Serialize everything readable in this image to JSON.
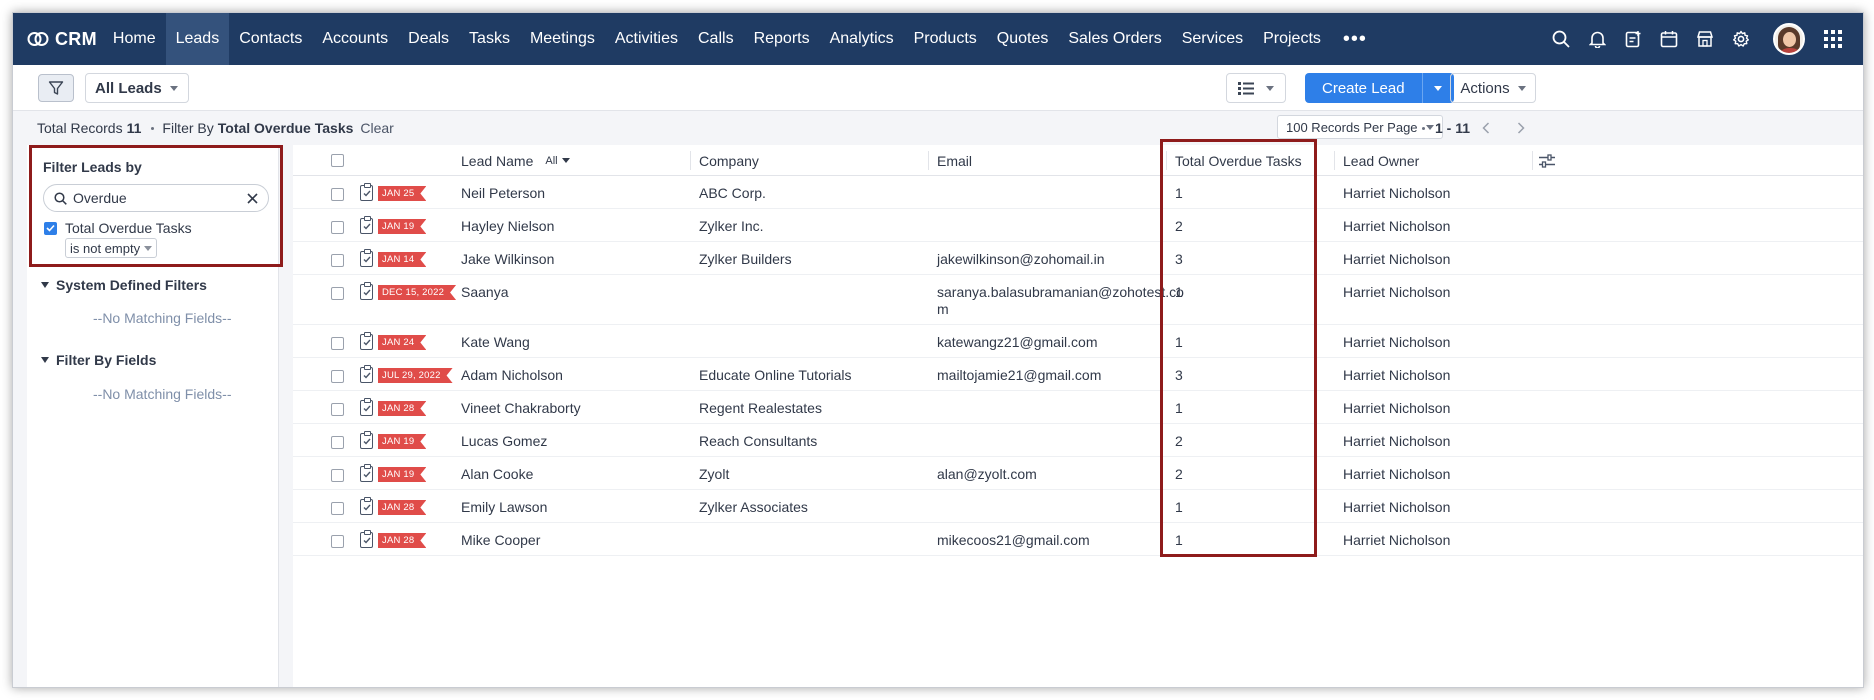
{
  "nav": {
    "logo_text": "CRM",
    "items": [
      "Home",
      "Leads",
      "Contacts",
      "Accounts",
      "Deals",
      "Tasks",
      "Meetings",
      "Activities",
      "Calls",
      "Reports",
      "Analytics",
      "Products",
      "Quotes",
      "Sales Orders",
      "Services",
      "Projects"
    ],
    "active": "Leads",
    "more_label": "•••"
  },
  "toolbar": {
    "view_label": "All Leads",
    "create_label": "Create Lead",
    "actions_label": "Actions"
  },
  "records": {
    "total_label": "Total Records",
    "total_count": "11",
    "filter_by_label": "Filter By",
    "filter_name": "Total Overdue Tasks",
    "clear_label": "Clear",
    "per_page": "100 Records Per Page",
    "range": "1 - 11"
  },
  "sidebar": {
    "title": "Filter Leads by",
    "search_value": "Overdue",
    "checkbox_label": "Total Overdue Tasks",
    "condition": "is not empty",
    "sections": [
      {
        "title": "System Defined Filters",
        "empty_text": "--No Matching Fields--"
      },
      {
        "title": "Filter By Fields",
        "empty_text": "--No Matching Fields--"
      }
    ]
  },
  "table": {
    "columns": {
      "lead_name": "Lead Name",
      "all_filter": "All",
      "company": "Company",
      "email": "Email",
      "overdue": "Total Overdue Tasks",
      "owner": "Lead Owner"
    },
    "rows": [
      {
        "tag": "JAN 25",
        "name": "Neil Peterson",
        "company": "ABC Corp.",
        "email": "",
        "overdue": "1",
        "owner": "Harriet Nicholson"
      },
      {
        "tag": "JAN 19",
        "name": "Hayley Nielson",
        "company": "Zylker Inc.",
        "email": "",
        "overdue": "2",
        "owner": "Harriet Nicholson"
      },
      {
        "tag": "JAN 14",
        "name": "Jake Wilkinson",
        "company": "Zylker Builders",
        "email": "jakewilkinson@zohomail.in",
        "overdue": "3",
        "owner": "Harriet Nicholson"
      },
      {
        "tag": "DEC 15, 2022",
        "name": "Saanya",
        "company": "",
        "email": "saranya.balasubramanian@zohotest.co",
        "email2": "m",
        "overdue": "1",
        "owner": "Harriet Nicholson"
      },
      {
        "tag": "JAN 24",
        "name": "Kate Wang",
        "company": "",
        "email": "katewangz21@gmail.com",
        "overdue": "1",
        "owner": "Harriet Nicholson"
      },
      {
        "tag": "JUL 29, 2022",
        "name": "Adam Nicholson",
        "company": "Educate Online Tutorials",
        "email": "mailtojamie21@gmail.com",
        "overdue": "3",
        "owner": "Harriet Nicholson"
      },
      {
        "tag": "JAN 28",
        "name": "Vineet Chakraborty",
        "company": "Regent Realestates",
        "email": "",
        "overdue": "1",
        "owner": "Harriet Nicholson"
      },
      {
        "tag": "JAN 19",
        "name": "Lucas Gomez",
        "company": "Reach Consultants",
        "email": "",
        "overdue": "2",
        "owner": "Harriet Nicholson"
      },
      {
        "tag": "JAN 19",
        "name": "Alan Cooke",
        "company": "Zyolt",
        "email": "alan@zyolt.com",
        "overdue": "2",
        "owner": "Harriet Nicholson"
      },
      {
        "tag": "JAN 28",
        "name": "Emily Lawson",
        "company": "Zylker Associates",
        "email": "",
        "overdue": "1",
        "owner": "Harriet Nicholson"
      },
      {
        "tag": "JAN 28",
        "name": "Mike Cooper",
        "company": "",
        "email": "mikecoos21@gmail.com",
        "overdue": "1",
        "owner": "Harriet Nicholson"
      }
    ]
  },
  "colors": {
    "nav_bg": "#1f3b63",
    "accent": "#2e7fe8",
    "tag_red": "#e04c49",
    "highlight": "#8e1b1b"
  },
  "icons": [
    "crm-logo-icon",
    "search-icon",
    "bell-icon",
    "add-record-icon",
    "calendar-icon",
    "marketplace-icon",
    "gear-icon",
    "apps-grid-icon",
    "filter-icon",
    "list-view-icon",
    "close-icon",
    "column-settings-icon",
    "task-icon"
  ]
}
